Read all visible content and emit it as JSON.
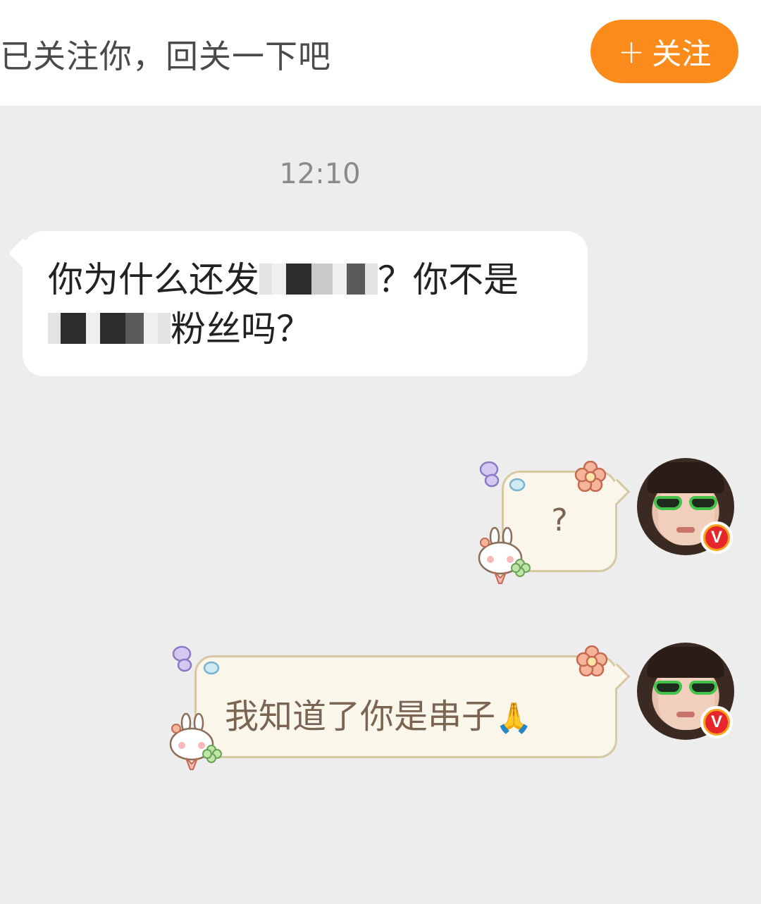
{
  "follow_bar": {
    "prompt_text": "已关注你，回关一下吧",
    "follow_button_label": "关注",
    "follow_button_icon": "+",
    "accent_color": "#fb8c1c"
  },
  "timestamp": "12:10",
  "messages": [
    {
      "direction": "incoming",
      "line1_prefix": "你为什么还发",
      "line1_suffix": "？你不是",
      "line2_suffix": "粉丝吗？",
      "redacted": "mosaic-blurred text"
    },
    {
      "direction": "outgoing",
      "text": "?",
      "verified_badge": "V"
    },
    {
      "direction": "outgoing",
      "text": "我知道了你是串子",
      "emoji": "🙏",
      "verified_badge": "V"
    }
  ],
  "icons": {
    "follow_icon": "plus-icon",
    "badge_icon": "verified-v-icon",
    "decor": [
      "butterfly-icon",
      "flower-icon",
      "bunny-icon",
      "clover-icon"
    ]
  }
}
